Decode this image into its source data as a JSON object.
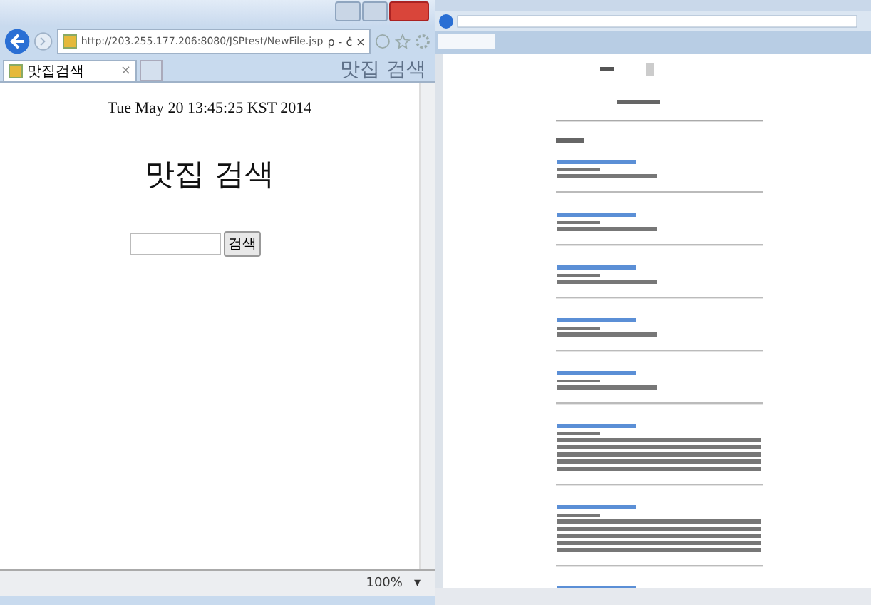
{
  "left_window": {
    "address": "http://203.255.177.206:8080/JSPtest/NewFile.jsp",
    "search_hint": "ρ - ċ ×",
    "tab": {
      "label": "맛집검색",
      "close": "×",
      "selected": true
    },
    "ghost_title": "맛집 검색",
    "page": {
      "date": "Tue May 20 13:45:25 KST 2014",
      "heading": "맛집 검색",
      "search_button": "검색"
    },
    "zoom": "100%",
    "zoom_caret": "▾"
  }
}
